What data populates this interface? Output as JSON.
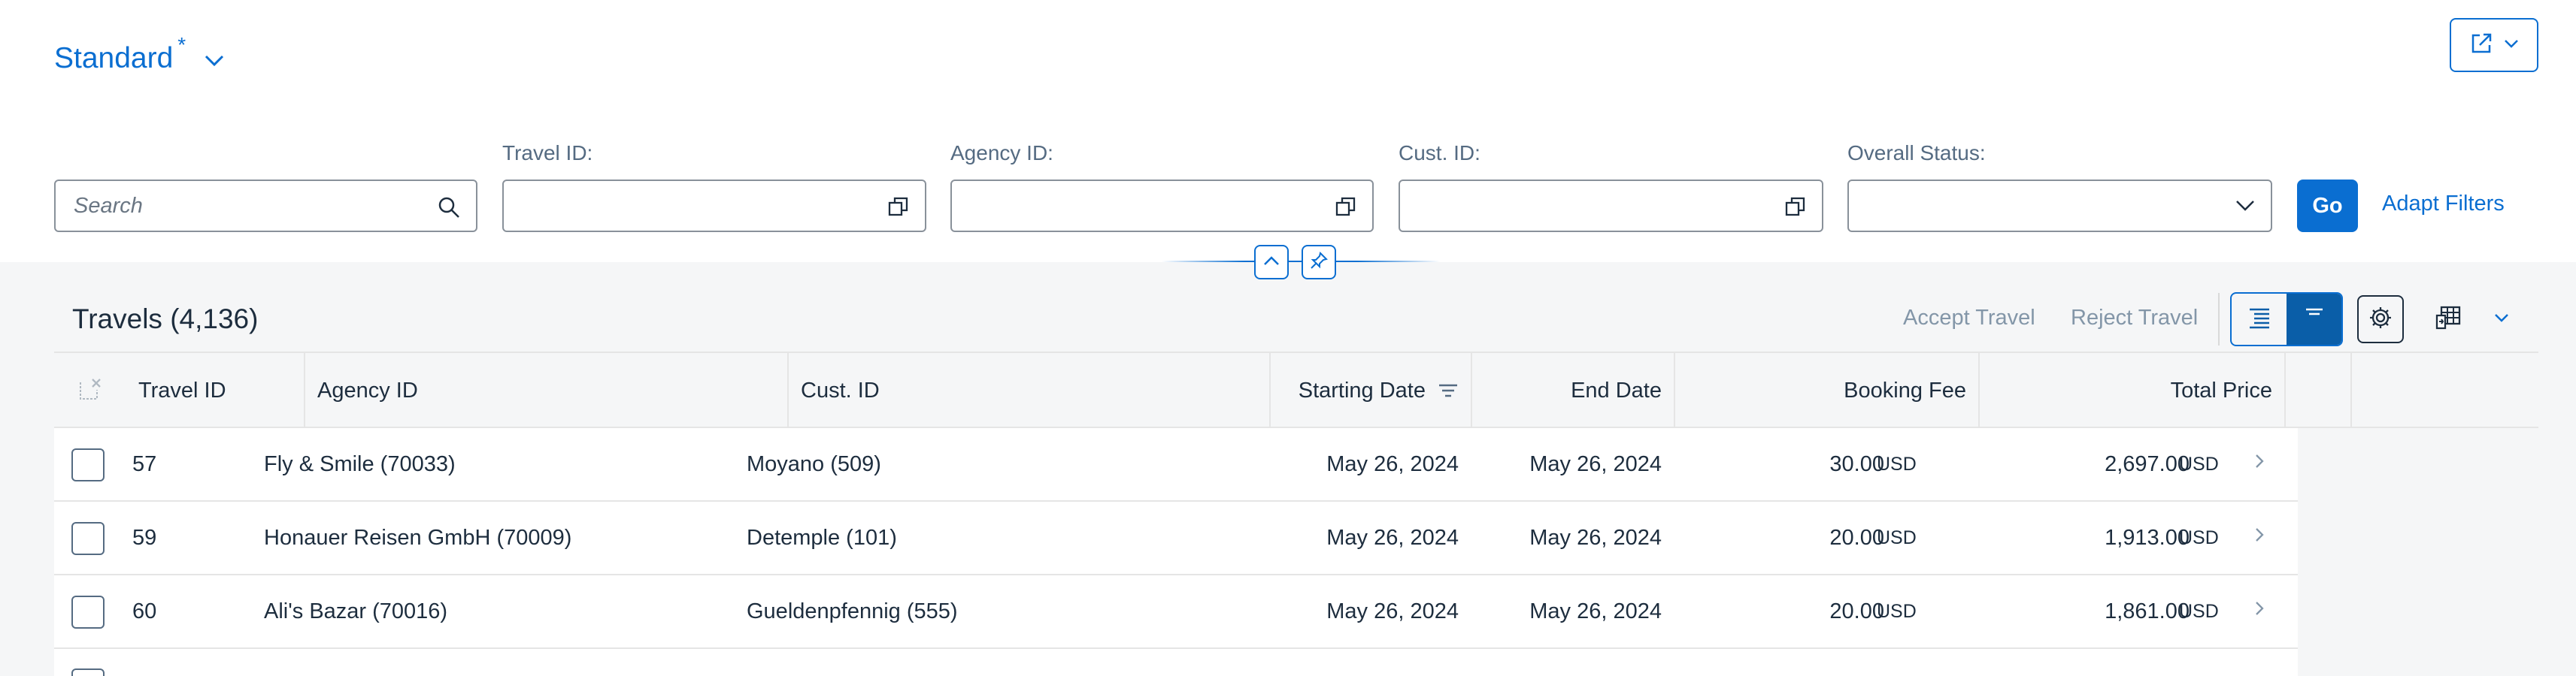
{
  "variant": {
    "title": "Standard",
    "modified_marker": "*"
  },
  "filter_bar": {
    "search_placeholder": "Search",
    "fields": [
      {
        "label": "Travel ID:",
        "value": ""
      },
      {
        "label": "Agency ID:",
        "value": ""
      },
      {
        "label": "Cust. ID:",
        "value": ""
      },
      {
        "label": "Overall Status:",
        "value": ""
      }
    ],
    "go_label": "Go",
    "adapt_filters_label": "Adapt Filters"
  },
  "table": {
    "title": "Travels (4,136)",
    "actions": {
      "accept": "Accept Travel",
      "reject": "Reject Travel"
    },
    "columns": [
      "Travel ID",
      "Agency ID",
      "Cust. ID",
      "Starting Date",
      "End Date",
      "Booking Fee",
      "Total Price"
    ],
    "sorted_column": "Starting Date",
    "rows": [
      {
        "travel_id": "57",
        "agency": "Fly & Smile (70033)",
        "customer": "Moyano (509)",
        "start": "May 26, 2024",
        "end": "May 26, 2024",
        "fee": "30.00",
        "fee_currency": "USD",
        "total": "2,697.00",
        "total_currency": "USD"
      },
      {
        "travel_id": "59",
        "agency": "Honauer Reisen GmbH (70009)",
        "customer": "Detemple (101)",
        "start": "May 26, 2024",
        "end": "May 26, 2024",
        "fee": "20.00",
        "fee_currency": "USD",
        "total": "1,913.00",
        "total_currency": "USD"
      },
      {
        "travel_id": "60",
        "agency": "Ali's Bazar (70016)",
        "customer": "Gueldenpfennig (555)",
        "start": "May 26, 2024",
        "end": "May 26, 2024",
        "fee": "20.00",
        "fee_currency": "USD",
        "total": "1,861.00",
        "total_currency": "USD"
      }
    ]
  },
  "icons": {
    "variant_dropdown": "chevron-down-icon",
    "share": "share-icon",
    "search": "search-icon",
    "value_help": "value-help-icon",
    "collapse": "chevron-up-icon",
    "pin": "pin-icon",
    "settings": "gear-icon",
    "export": "export-icon",
    "row_navigation": "chevron-right-icon"
  },
  "colors": {
    "accent": "#0a6ed1",
    "text": "#1d2d3e",
    "muted": "#556b82",
    "disabled": "#8396a8"
  }
}
